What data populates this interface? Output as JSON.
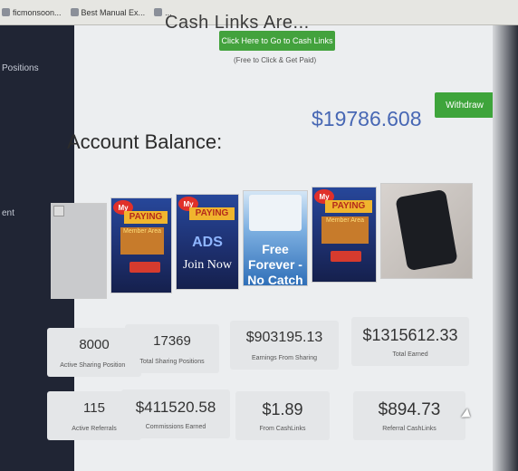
{
  "browser": {
    "bookmarks": [
      {
        "label": "ficmonsoon..."
      },
      {
        "label": "Best Manual Ex..."
      },
      {
        "label": "..."
      }
    ]
  },
  "sidebar": {
    "items": [
      {
        "label": "Positions"
      },
      {
        "label": "ent"
      }
    ]
  },
  "cash_links": {
    "heading": "Cash Links Are...",
    "button_label": "Click Here to Go to Cash Links",
    "note": "(Free to Click & Get Paid)"
  },
  "account": {
    "label": "Account Balance:",
    "balance": "$19786.608",
    "withdraw_label": "Withdraw"
  },
  "banners": [
    {
      "type": "placeholder"
    },
    {
      "type": "paying",
      "badge": "My",
      "title": "PAYING",
      "subtitle": "Member Area"
    },
    {
      "type": "paying",
      "badge": "My",
      "title": "PAYING",
      "middle": "ADS",
      "cta": "Join Now"
    },
    {
      "type": "free",
      "text": "Free Forever - No Catch"
    },
    {
      "type": "paying",
      "badge": "My",
      "title": "PAYING",
      "subtitle": "Member Area"
    },
    {
      "type": "phone"
    }
  ],
  "stats": [
    {
      "value": "8000",
      "label": "Active Sharing Positions"
    },
    {
      "value": "17369",
      "label": "Total Sharing Positions"
    },
    {
      "value": "$903195.13",
      "label": "Earnings From Sharing"
    },
    {
      "value": "$1315612.33",
      "label": "Total Earned"
    },
    {
      "value": "115",
      "label": "Active Referrals"
    },
    {
      "value": "$411520.58",
      "label": "Commissions Earned"
    },
    {
      "value": "$1.89",
      "label": "From CashLinks"
    },
    {
      "value": "$894.73",
      "label": "Referral CashLinks"
    }
  ],
  "colors": {
    "accent_green": "#43a23d",
    "balance_blue": "#4767b4",
    "sidebar_bg": "#202534"
  }
}
